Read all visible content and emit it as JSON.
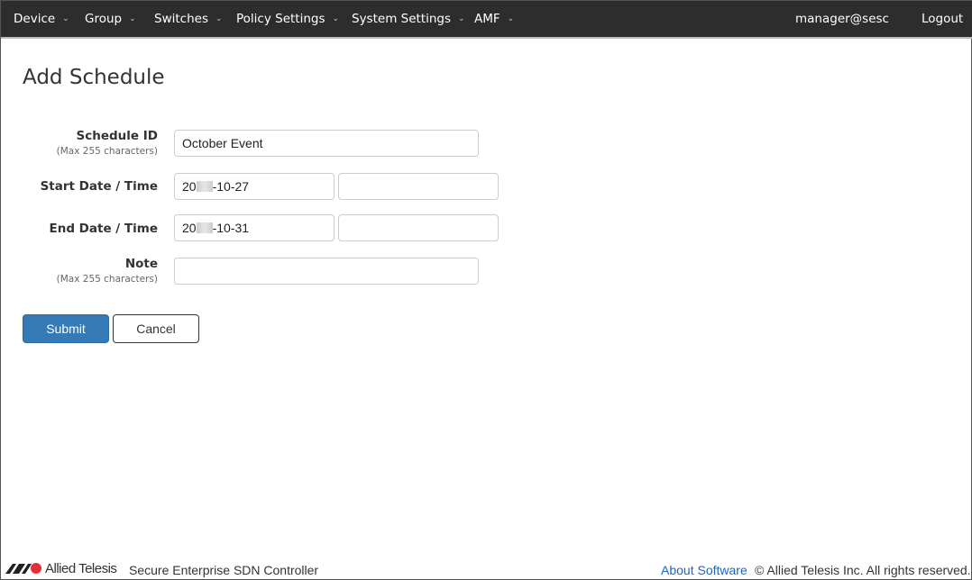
{
  "nav": {
    "items": [
      {
        "label": "Device"
      },
      {
        "label": "Group"
      },
      {
        "label": "Switches"
      },
      {
        "label": "Policy Settings"
      },
      {
        "label": "System Settings"
      },
      {
        "label": "AMF"
      }
    ],
    "user": "manager@sesc",
    "logout": "Logout"
  },
  "page": {
    "title": "Add Schedule"
  },
  "form": {
    "schedule_id": {
      "label": "Schedule ID",
      "hint": "(Max 255 characters)",
      "value": "October Event"
    },
    "start": {
      "label": "Start Date / Time",
      "date_prefix": "20",
      "date_suffix": "-10-27",
      "time": ""
    },
    "end": {
      "label": "End Date / Time",
      "date_prefix": "20",
      "date_suffix": "-10-31",
      "time": ""
    },
    "note": {
      "label": "Note",
      "hint": "(Max 255 characters)",
      "value": ""
    },
    "submit": "Submit",
    "cancel": "Cancel"
  },
  "footer": {
    "brand": "Allied Telesis",
    "product": "Secure Enterprise SDN Controller",
    "about": "About Software",
    "copyright": "© Allied Telesis Inc. All rights reserved."
  },
  "colors": {
    "nav_bg": "#2d2d2d",
    "primary": "#337ab7"
  }
}
